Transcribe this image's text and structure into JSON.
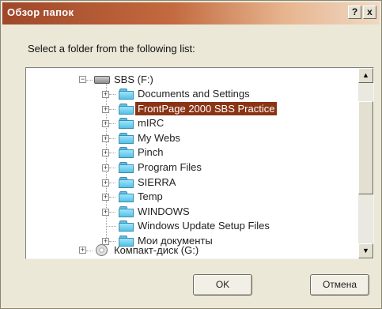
{
  "dialog": {
    "title": "Обзор папок",
    "help_label": "?",
    "close_label": "x",
    "prompt": "Select a folder from the following list:"
  },
  "tree": {
    "drive_label": "SBS (F:)",
    "selected_index": 1,
    "items": [
      {
        "label": "Documents and Settings",
        "icon": "folder-icon",
        "expandable": true
      },
      {
        "label": "FrontPage 2000 SBS Practice",
        "icon": "folder-icon",
        "expandable": true
      },
      {
        "label": "mIRC",
        "icon": "folder-icon",
        "expandable": true
      },
      {
        "label": "My Webs",
        "icon": "folder-icon",
        "expandable": true
      },
      {
        "label": "Pinch",
        "icon": "folder-icon",
        "expandable": true
      },
      {
        "label": "Program Files",
        "icon": "folder-icon",
        "expandable": true
      },
      {
        "label": "SIERRA",
        "icon": "folder-icon",
        "expandable": true
      },
      {
        "label": "Temp",
        "icon": "folder-icon",
        "expandable": true
      },
      {
        "label": "WINDOWS",
        "icon": "folder-icon",
        "expandable": true
      },
      {
        "label": "Windows Update Setup Files",
        "icon": "folder-icon",
        "expandable": false
      },
      {
        "label": "Мои документы",
        "icon": "folder-icon",
        "expandable": true
      }
    ],
    "cd_label": "Компакт-диск (G:)",
    "expand_symbol": "+",
    "collapse_symbol": "−"
  },
  "scrollbar": {
    "up_arrow": "▲",
    "down_arrow": "▼"
  },
  "buttons": {
    "ok": "OK",
    "cancel": "Отмена"
  },
  "colors": {
    "selection": "#8a3415",
    "title_start": "#a0472a",
    "folder": "#55c2e6"
  }
}
